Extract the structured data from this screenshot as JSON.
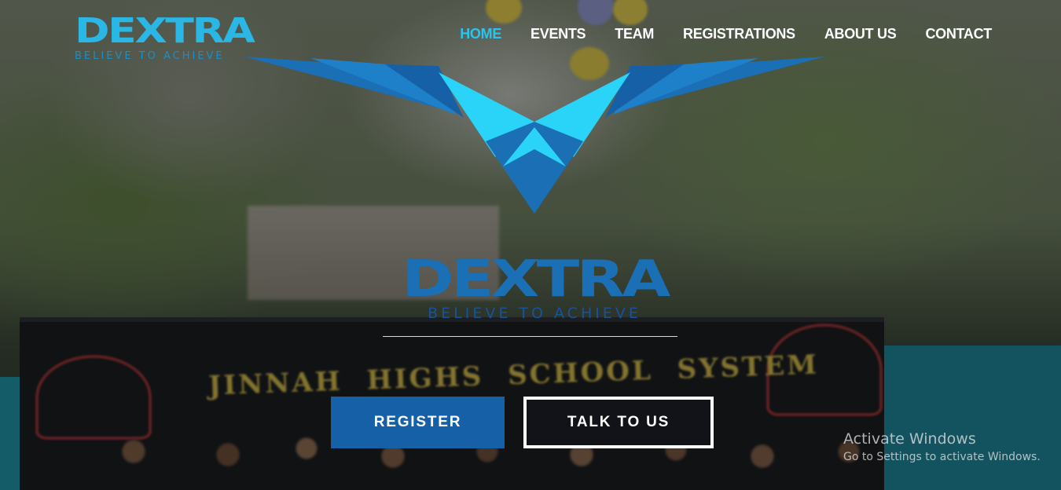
{
  "brand": {
    "name": "DEXTRA",
    "tagline": "BELIEVE TO ACHIEVE"
  },
  "nav": {
    "items": [
      {
        "label": "HOME",
        "active": true
      },
      {
        "label": "EVENTS",
        "active": false
      },
      {
        "label": "TEAM",
        "active": false
      },
      {
        "label": "REGISTRATIONS",
        "active": false
      },
      {
        "label": "ABOUT US",
        "active": false
      },
      {
        "label": "CONTACT",
        "active": false
      }
    ]
  },
  "hero": {
    "logo_name": "DEXTRA",
    "logo_tagline": "BELIEVE TO ACHIEVE",
    "background_banner_text": "JINNAH HIGHS SCHOOL SYSTEM",
    "buttons": {
      "register": "REGISTER",
      "talk": "TALK TO US"
    }
  },
  "watermark": {
    "title": "Activate Windows",
    "subtitle": "Go to Settings to activate Windows."
  },
  "colors": {
    "accent_cyan": "#2bc4ec",
    "brand_blue": "#1a6fb5",
    "register_button": "#1660a8",
    "nav_text": "#ffffff"
  }
}
